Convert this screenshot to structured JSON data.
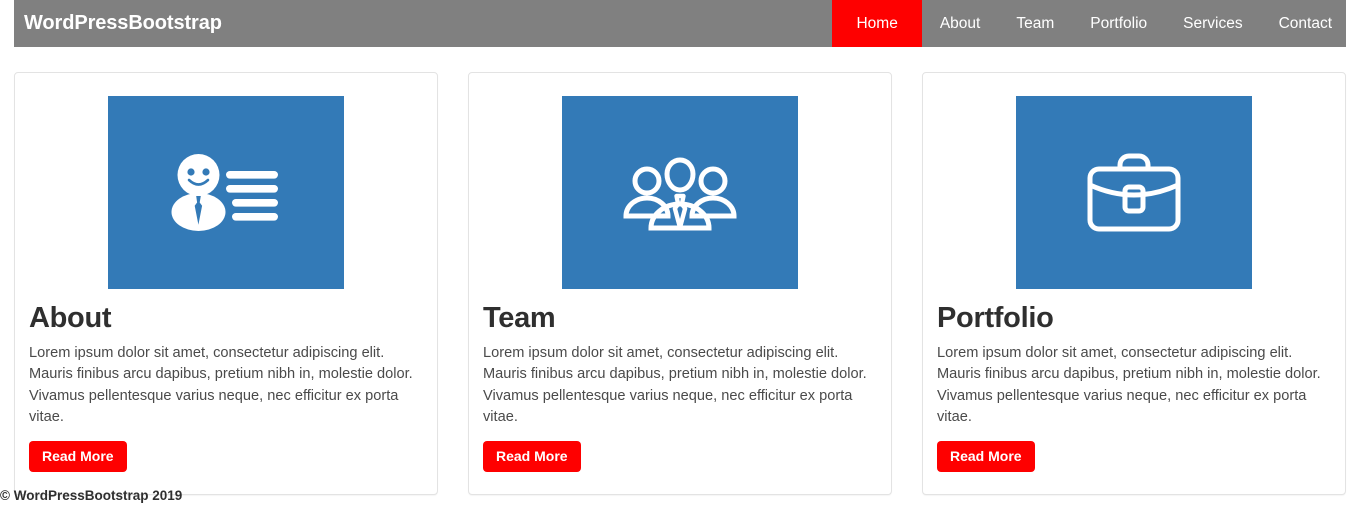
{
  "header": {
    "brand": "WordPressBootstrap",
    "nav": [
      {
        "label": "Home",
        "active": true
      },
      {
        "label": "About",
        "active": false
      },
      {
        "label": "Team",
        "active": false
      },
      {
        "label": "Portfolio",
        "active": false
      },
      {
        "label": "Services",
        "active": false
      },
      {
        "label": "Contact",
        "active": false
      }
    ]
  },
  "cards": [
    {
      "icon": "person-id-card-icon",
      "title": "About",
      "text": "Lorem ipsum dolor sit amet, consectetur adipiscing elit. Mauris finibus arcu dapibus, pretium nibh in, molestie dolor. Vivamus pellentesque varius neque, nec efficitur ex porta vitae.",
      "button": "Read More"
    },
    {
      "icon": "people-group-icon",
      "title": "Team",
      "text": "Lorem ipsum dolor sit amet, consectetur adipiscing elit. Mauris finibus arcu dapibus, pretium nibh in, molestie dolor. Vivamus pellentesque varius neque, nec efficitur ex porta vitae.",
      "button": "Read More"
    },
    {
      "icon": "briefcase-icon",
      "title": "Portfolio",
      "text": "Lorem ipsum dolor sit amet, consectetur adipiscing elit. Mauris finibus arcu dapibus, pretium nibh in, molestie dolor. Vivamus pellentesque varius neque, nec efficitur ex porta vitae.",
      "button": "Read More"
    }
  ],
  "footer": {
    "copyright": "© WordPressBootstrap 2019"
  },
  "colors": {
    "navbar_bg": "#808080",
    "accent_red": "#fe0000",
    "media_blue": "#337ab7",
    "card_border": "#e3e3e3",
    "title_text": "#2f2f2f",
    "body_text": "#4a4a4a"
  }
}
